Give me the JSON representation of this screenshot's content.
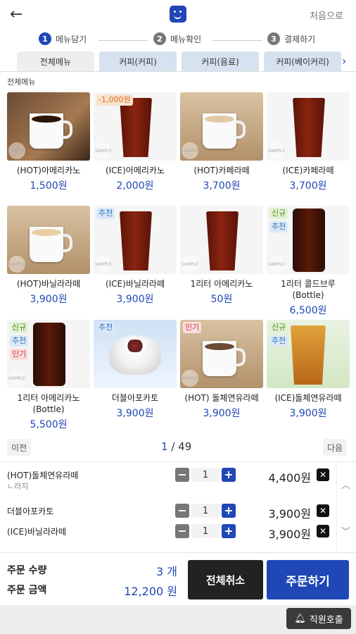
{
  "topbar": {
    "back_icon": "arrow-left-icon",
    "home_label": "처음으로"
  },
  "steps": [
    {
      "num": "1",
      "label": "메뉴담기"
    },
    {
      "num": "2",
      "label": "메뉴확인"
    },
    {
      "num": "3",
      "label": "결제하기"
    }
  ],
  "tabs": [
    {
      "label": "전체메뉴"
    },
    {
      "label": "커피(커피)"
    },
    {
      "label": "커피(음료)"
    },
    {
      "label": "커피(베이커리)"
    }
  ],
  "section_title": "전체메뉴",
  "menu": [
    {
      "name": "(HOT)아메리카노",
      "price": "1,500원",
      "badges": []
    },
    {
      "name": "(ICE)아메리카노",
      "price": "2,000원",
      "badges": [
        "-1,000원"
      ]
    },
    {
      "name": "(HOT)카페라떼",
      "price": "3,700원",
      "badges": []
    },
    {
      "name": "(ICE)카페라떼",
      "price": "3,700원",
      "badges": []
    },
    {
      "name": "(HOT)바닐라라떼",
      "price": "3,900원",
      "badges": []
    },
    {
      "name": "(ICE)바닐라라떼",
      "price": "3,900원",
      "badges": [
        "추천"
      ]
    },
    {
      "name": "1리터 아메리카노",
      "price": "50원",
      "badges": []
    },
    {
      "name": "1리터 콜드브루 (Bottle)",
      "price": "6,500원",
      "badges": [
        "신규",
        "추천"
      ]
    },
    {
      "name": "1리터 아메리카노 (Bottle)",
      "price": "5,500원",
      "badges": [
        "신규",
        "추천",
        "인기"
      ]
    },
    {
      "name": "더블아포카토",
      "price": "3,900원",
      "badges": [
        "추천"
      ]
    },
    {
      "name": "(HOT) 돌체연유라떼",
      "price": "3,900원",
      "badges": [
        "인기"
      ]
    },
    {
      "name": "(ICE)돌체연유라떼",
      "price": "3,900원",
      "badges": [
        "신규",
        "추천"
      ]
    }
  ],
  "sample_label": "SAMPLE",
  "pager": {
    "prev": "이전",
    "next": "다음",
    "current": "1",
    "total": "/ 49"
  },
  "cart": [
    {
      "name": "(HOT)돌체연유라떼",
      "option": "ㄴ라지",
      "qty": "1",
      "price": "4,400원"
    },
    {
      "name": "더블아포카토",
      "option": "",
      "qty": "1",
      "price": "3,900원"
    },
    {
      "name": "(ICE)바닐라라떼",
      "option": "",
      "qty": "1",
      "price": "3,900원"
    }
  ],
  "totals": {
    "qty_label": "주문 수량",
    "qty_value": "3 개",
    "amount_label": "주문 금액",
    "amount_value": "12,200 원"
  },
  "buttons": {
    "cancel_all": "전체취소",
    "order": "주문하기",
    "call_staff": "직원호출"
  },
  "colors": {
    "accent": "#1f47b6",
    "tab_bg": "#d7e2f0",
    "dark_button": "#222222"
  }
}
